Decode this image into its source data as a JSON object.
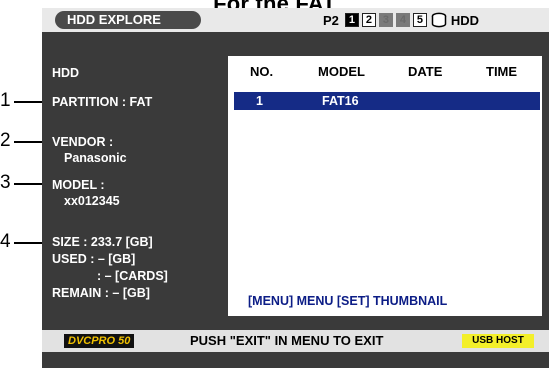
{
  "caption": "For the FAT",
  "header": {
    "title": "HDD EXPLORE",
    "p2": "P2",
    "slots": [
      "1",
      "2",
      "3",
      "4",
      "5"
    ],
    "device": "HDD"
  },
  "left": {
    "heading": "HDD",
    "partition": "PARTITION : FAT",
    "vendor_label": "VENDOR :",
    "vendor_value": "Panasonic",
    "model_label": "MODEL :",
    "model_value": "xx012345",
    "size": "SIZE : 233.7 [GB]",
    "used": "USED : – [GB]",
    "cards": ": – [CARDS]",
    "remain": "REMAIN : – [GB]"
  },
  "callouts": [
    "1",
    "2",
    "3",
    "4"
  ],
  "table": {
    "headers": [
      "NO.",
      "MODEL",
      "DATE",
      "TIME"
    ],
    "rows": [
      {
        "no": "1",
        "model": "FAT16",
        "date": "",
        "time": ""
      }
    ]
  },
  "footer_hint": "[MENU] MENU   [SET] THUMBNAIL",
  "bottom": {
    "brand": "DVCPRO 50",
    "message": "PUSH \"EXIT\" IN MENU TO EXIT",
    "usb": "USB HOST"
  }
}
